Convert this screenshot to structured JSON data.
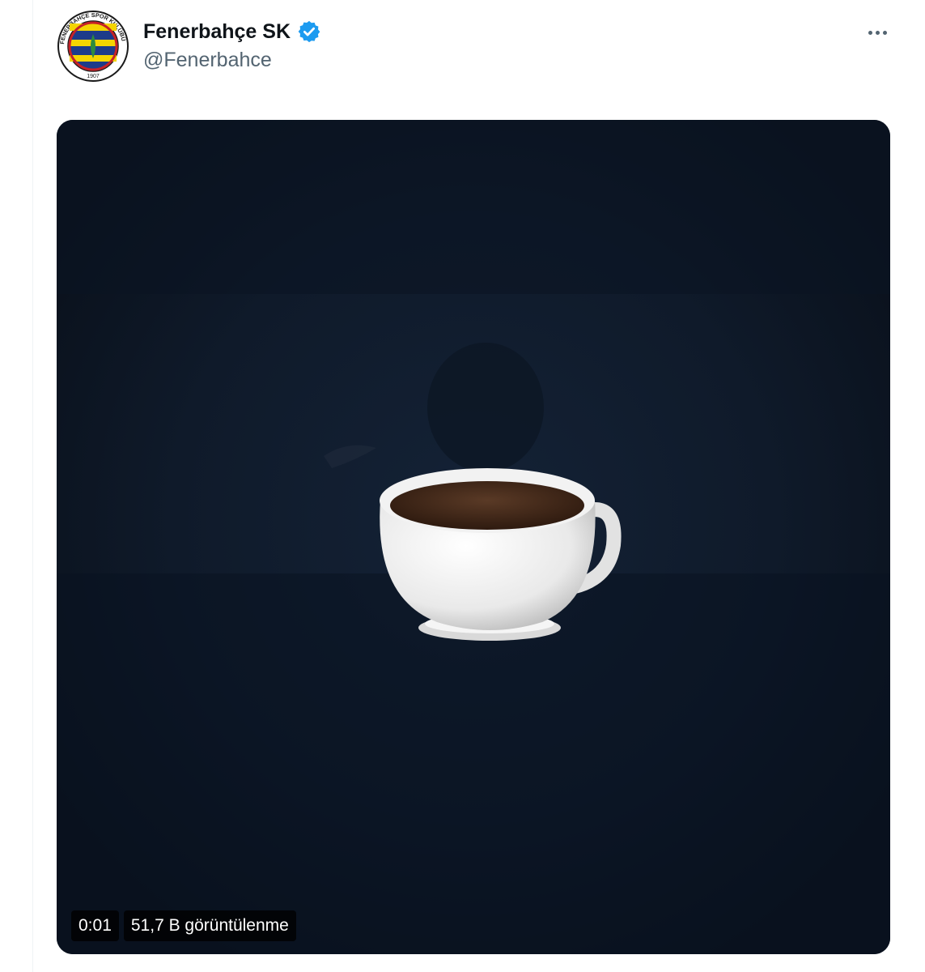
{
  "tweet": {
    "display_name": "Fenerbahçe SK",
    "handle": "@Fenerbahce",
    "verified_icon": "verified-badge-icon",
    "more_icon": "more-options-icon",
    "avatar": {
      "label": "Fenerbahçe Spor Kulübü logo",
      "year": "1907",
      "ring_text": "FENERBAHÇE SPOR KULÜBÜ"
    }
  },
  "media": {
    "type": "video",
    "content": "coffee-cup-emoji",
    "time_label": "0:01",
    "views_label": "51,7 B görüntülenme"
  },
  "colors": {
    "name": "#0f1419",
    "handle": "#536471",
    "verified": "#1d9bf0",
    "media_bg": "#0d1624",
    "club_yellow": "#f4d400",
    "club_navy": "#1d3b8a"
  }
}
